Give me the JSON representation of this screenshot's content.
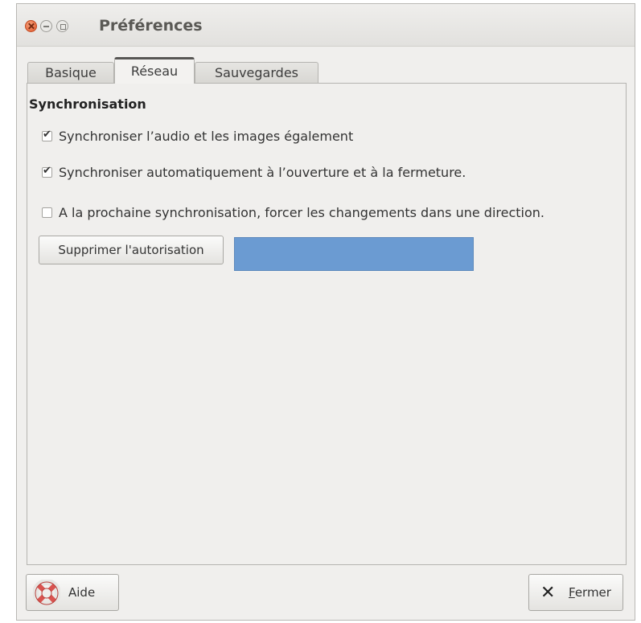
{
  "window": {
    "title": "Préférences"
  },
  "tabs": [
    {
      "label": "Basique",
      "active": false
    },
    {
      "label": "Réseau",
      "active": true
    },
    {
      "label": "Sauvegardes",
      "active": false
    }
  ],
  "sync": {
    "section_title": "Synchronisation",
    "options": [
      {
        "label": "Synchroniser l’audio et les images également",
        "checked": true
      },
      {
        "label": "Synchroniser automatiquement à l’ouverture et à la fermeture.",
        "checked": true
      },
      {
        "label": "A la prochaine synchronisation, forcer les changements dans une direction.",
        "checked": false
      }
    ],
    "revoke_label": "Supprimer l'autorisation"
  },
  "footer": {
    "help_label": "Aide",
    "close_mnemonic": "F",
    "close_rest": "ermer"
  },
  "icons": {
    "help": "lifebuoy-icon",
    "close": "x-icon"
  },
  "colors": {
    "redaction": "#6b9bd2",
    "window_close": "#e0562a",
    "help_icon": "#d9534f"
  }
}
